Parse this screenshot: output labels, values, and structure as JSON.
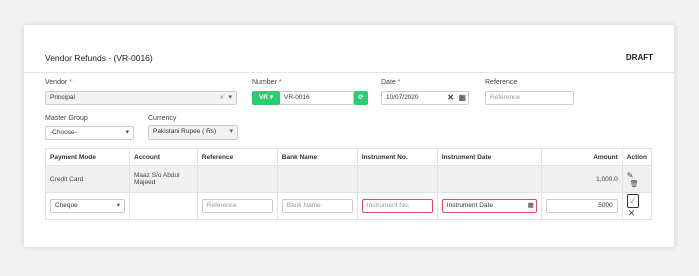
{
  "header": {
    "title": "Vendor Refunds - (VR-0016)",
    "status": "DRAFT"
  },
  "form": {
    "vendor_label": "Vendor",
    "vendor_value": "Principal",
    "number_label": "Number",
    "number_prefix": "VR",
    "number_value": "VR-0016",
    "date_label": "Date",
    "date_value": "10/07/2020",
    "reference_label": "Reference",
    "reference_placeholder": "Reference",
    "master_group_label": "Master Group",
    "master_group_value": "-Choose-",
    "currency_label": "Currency",
    "currency_value": "Pakistani Rupee ( Rs)"
  },
  "table": {
    "headers": [
      "Payment Mode",
      "Account",
      "Reference",
      "Bank Name",
      "Instrument No.",
      "Instrument Date",
      "Amount",
      "Action"
    ],
    "row": {
      "payment_mode": "Credit Card",
      "account": "Maaz S/o Abdul Majeed",
      "amount": "1,000.0"
    },
    "new_row": {
      "payment_mode": "Cheque",
      "reference_placeholder": "Reference",
      "bank_placeholder": "Bank Name",
      "instrument_no_placeholder": "Instrument No.",
      "instrument_date_placeholder": "Instrument Date",
      "amount": "5000"
    }
  },
  "colors": {
    "accent": "#2ecc71",
    "error": "#e04a5a"
  }
}
